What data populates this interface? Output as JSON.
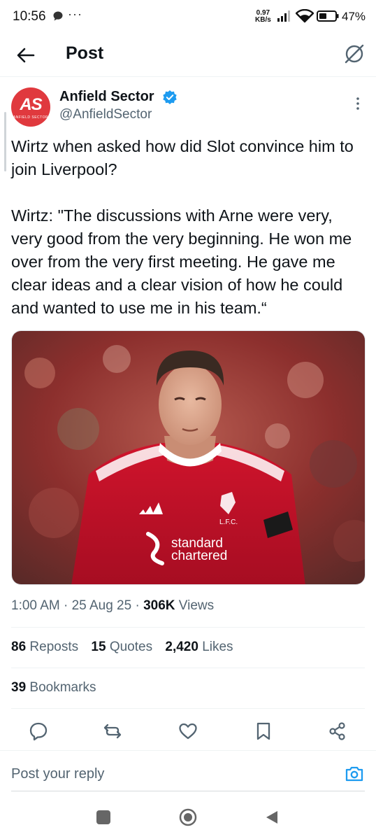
{
  "status_bar": {
    "time": "10:56",
    "dots": "···",
    "net_speed_value": "0.97",
    "net_speed_unit": "KB/s",
    "battery": "47%"
  },
  "header": {
    "title": "Post",
    "back_icon": "arrow-left-icon",
    "grok_icon": "grok-icon"
  },
  "author": {
    "avatar_initials": "AS",
    "avatar_subtext": "ANFIELD SECTOR",
    "name": "Anfield Sector",
    "handle": "@AnfieldSector",
    "verified": true
  },
  "tweet": {
    "line1": "Wirtz when asked how did Slot convince him to join Liverpool?",
    "line2": "Wirtz: \"The discussions with Arne were very, very good from the very beginning. He won me over from the very first meeting. He gave me clear ideas and a clear vision of how he could and wanted to use me in his team.“"
  },
  "media": {
    "sponsor_line1": "standard",
    "sponsor_line2": "chartered",
    "crest_text": "L.F.C."
  },
  "meta": {
    "time": "1:00 AM",
    "sep": "·",
    "date": "25 Aug 25",
    "views_count": "306K",
    "views_label": "Views"
  },
  "stats": {
    "reposts_count": "86",
    "reposts_label": "Reposts",
    "quotes_count": "15",
    "quotes_label": "Quotes",
    "likes_count": "2,420",
    "likes_label": "Likes",
    "bookmarks_count": "39",
    "bookmarks_label": "Bookmarks"
  },
  "reply": {
    "placeholder": "Post your reply"
  },
  "colors": {
    "accent": "#1d9bf0",
    "text": "#0f1419",
    "secondary": "#536471",
    "avatar_bg": "#e0393e",
    "kit_red": "#c8102e"
  }
}
